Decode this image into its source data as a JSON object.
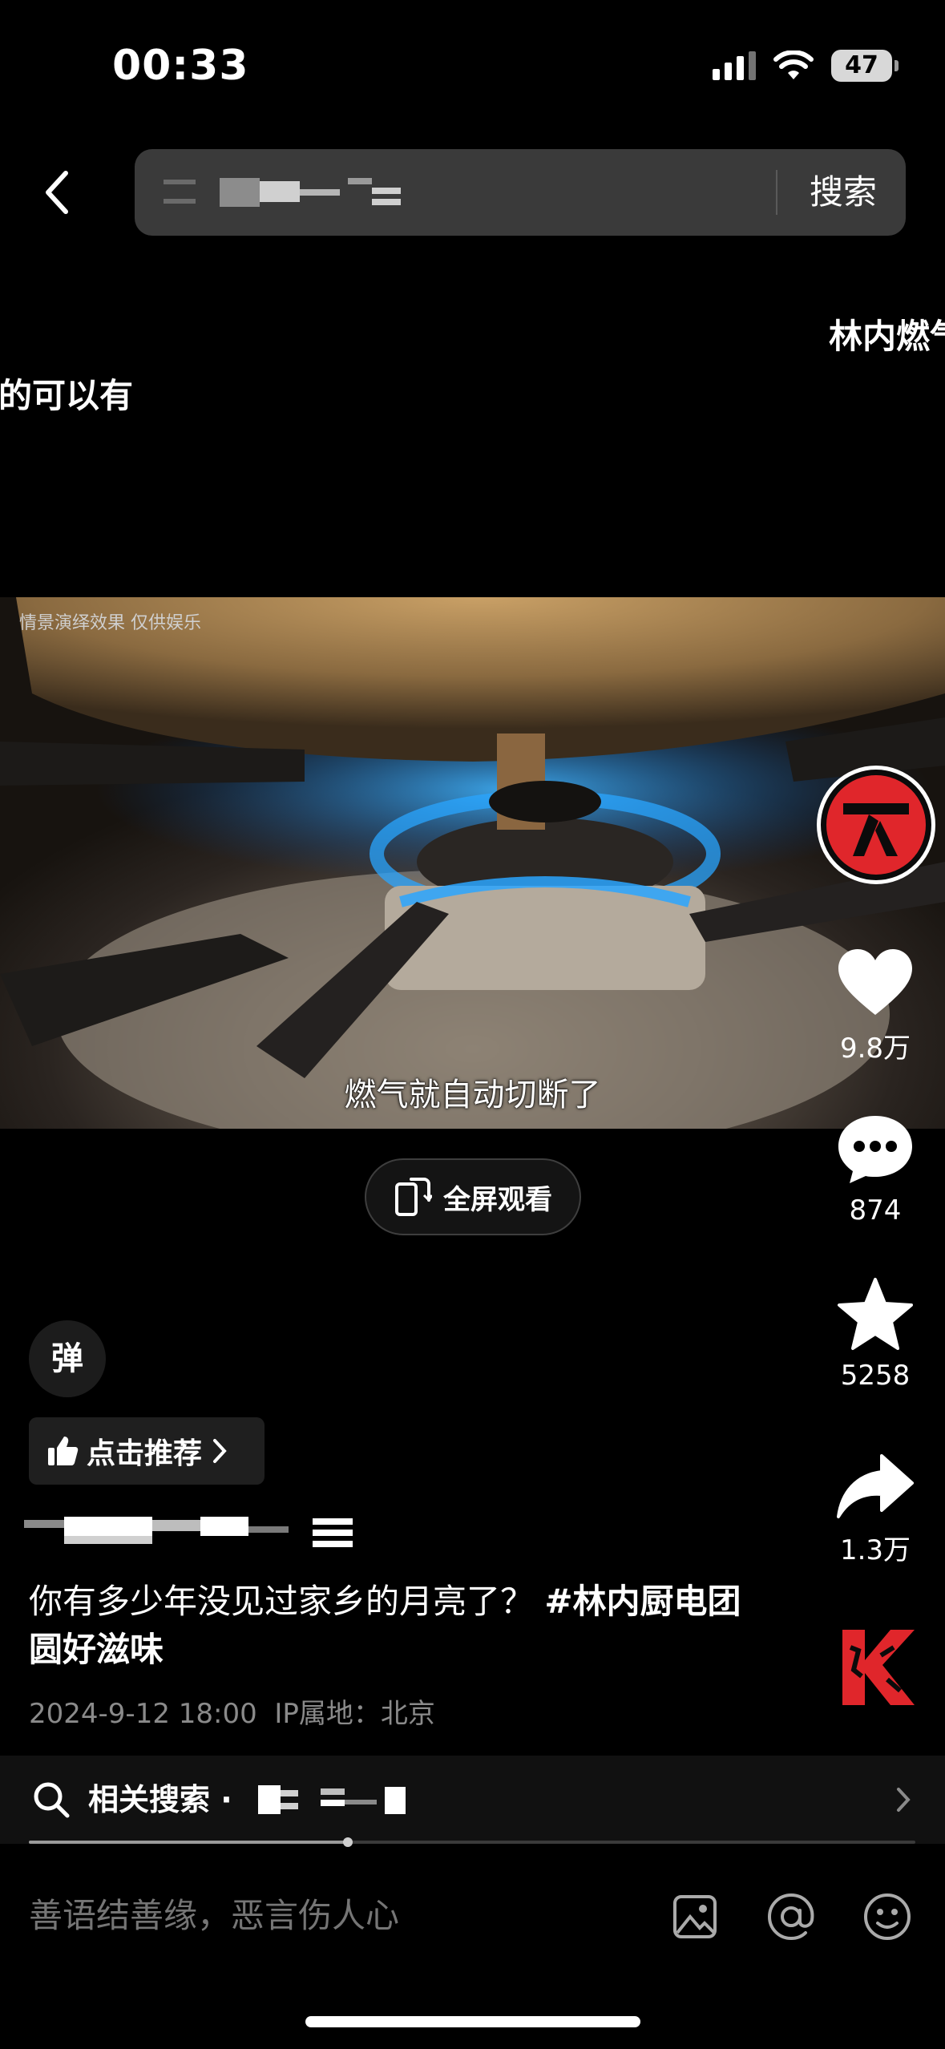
{
  "status_bar": {
    "time": "00:33",
    "battery": "47"
  },
  "search": {
    "button_label": "搜索"
  },
  "danmaku": [
    {
      "text": "林内燃气"
    },
    {
      "text": "真的可以有"
    }
  ],
  "video": {
    "disclaimer": "情景演绎效果 仅供娱乐",
    "subtitle": "燃气就自动切断了"
  },
  "fullscreen_label": "全屏观看",
  "actions": {
    "like_count": "9.8万",
    "comment_count": "874",
    "favorite_count": "5258",
    "share_count": "1.3万"
  },
  "danmaku_toggle_label": "弹",
  "recommend_label": "点击推荐",
  "post": {
    "text": "你有多少年没见过家乡的月亮了？ ",
    "hashtag": "#林内厨电团圆好滋味",
    "date": "2024-9-12 18:00",
    "ip_location": "IP属地：北京"
  },
  "related_search": {
    "label": "相关搜索 ·"
  },
  "video_progress": 0.36,
  "comment_placeholder": "善语结善缘，恶言伤人心",
  "colors": {
    "accent": "#e0262b",
    "flame": "#2aa6ff",
    "background": "#000000"
  }
}
